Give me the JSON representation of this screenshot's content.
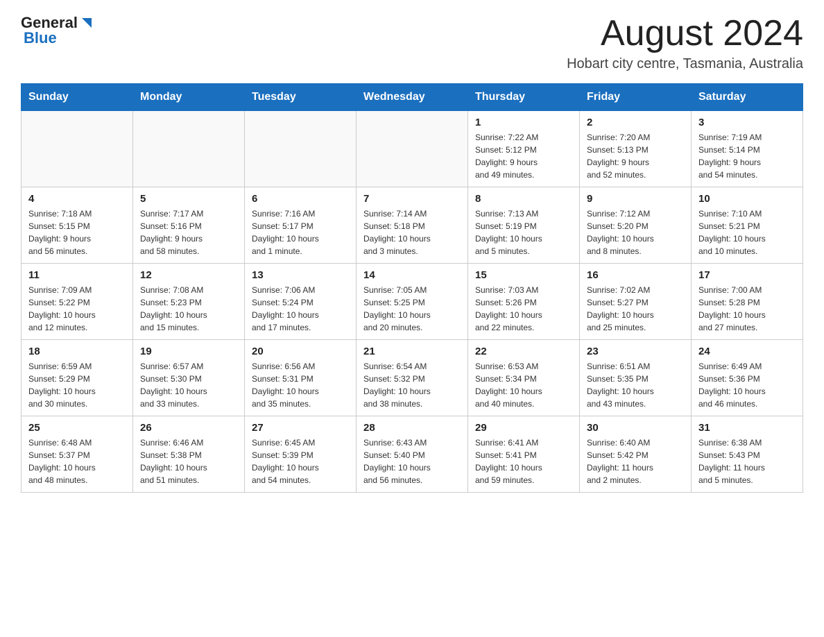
{
  "header": {
    "logo_general": "General",
    "logo_blue": "Blue",
    "title": "August 2024",
    "subtitle": "Hobart city centre, Tasmania, Australia"
  },
  "weekdays": [
    "Sunday",
    "Monday",
    "Tuesday",
    "Wednesday",
    "Thursday",
    "Friday",
    "Saturday"
  ],
  "weeks": [
    [
      {
        "day": "",
        "info": ""
      },
      {
        "day": "",
        "info": ""
      },
      {
        "day": "",
        "info": ""
      },
      {
        "day": "",
        "info": ""
      },
      {
        "day": "1",
        "info": "Sunrise: 7:22 AM\nSunset: 5:12 PM\nDaylight: 9 hours\nand 49 minutes."
      },
      {
        "day": "2",
        "info": "Sunrise: 7:20 AM\nSunset: 5:13 PM\nDaylight: 9 hours\nand 52 minutes."
      },
      {
        "day": "3",
        "info": "Sunrise: 7:19 AM\nSunset: 5:14 PM\nDaylight: 9 hours\nand 54 minutes."
      }
    ],
    [
      {
        "day": "4",
        "info": "Sunrise: 7:18 AM\nSunset: 5:15 PM\nDaylight: 9 hours\nand 56 minutes."
      },
      {
        "day": "5",
        "info": "Sunrise: 7:17 AM\nSunset: 5:16 PM\nDaylight: 9 hours\nand 58 minutes."
      },
      {
        "day": "6",
        "info": "Sunrise: 7:16 AM\nSunset: 5:17 PM\nDaylight: 10 hours\nand 1 minute."
      },
      {
        "day": "7",
        "info": "Sunrise: 7:14 AM\nSunset: 5:18 PM\nDaylight: 10 hours\nand 3 minutes."
      },
      {
        "day": "8",
        "info": "Sunrise: 7:13 AM\nSunset: 5:19 PM\nDaylight: 10 hours\nand 5 minutes."
      },
      {
        "day": "9",
        "info": "Sunrise: 7:12 AM\nSunset: 5:20 PM\nDaylight: 10 hours\nand 8 minutes."
      },
      {
        "day": "10",
        "info": "Sunrise: 7:10 AM\nSunset: 5:21 PM\nDaylight: 10 hours\nand 10 minutes."
      }
    ],
    [
      {
        "day": "11",
        "info": "Sunrise: 7:09 AM\nSunset: 5:22 PM\nDaylight: 10 hours\nand 12 minutes."
      },
      {
        "day": "12",
        "info": "Sunrise: 7:08 AM\nSunset: 5:23 PM\nDaylight: 10 hours\nand 15 minutes."
      },
      {
        "day": "13",
        "info": "Sunrise: 7:06 AM\nSunset: 5:24 PM\nDaylight: 10 hours\nand 17 minutes."
      },
      {
        "day": "14",
        "info": "Sunrise: 7:05 AM\nSunset: 5:25 PM\nDaylight: 10 hours\nand 20 minutes."
      },
      {
        "day": "15",
        "info": "Sunrise: 7:03 AM\nSunset: 5:26 PM\nDaylight: 10 hours\nand 22 minutes."
      },
      {
        "day": "16",
        "info": "Sunrise: 7:02 AM\nSunset: 5:27 PM\nDaylight: 10 hours\nand 25 minutes."
      },
      {
        "day": "17",
        "info": "Sunrise: 7:00 AM\nSunset: 5:28 PM\nDaylight: 10 hours\nand 27 minutes."
      }
    ],
    [
      {
        "day": "18",
        "info": "Sunrise: 6:59 AM\nSunset: 5:29 PM\nDaylight: 10 hours\nand 30 minutes."
      },
      {
        "day": "19",
        "info": "Sunrise: 6:57 AM\nSunset: 5:30 PM\nDaylight: 10 hours\nand 33 minutes."
      },
      {
        "day": "20",
        "info": "Sunrise: 6:56 AM\nSunset: 5:31 PM\nDaylight: 10 hours\nand 35 minutes."
      },
      {
        "day": "21",
        "info": "Sunrise: 6:54 AM\nSunset: 5:32 PM\nDaylight: 10 hours\nand 38 minutes."
      },
      {
        "day": "22",
        "info": "Sunrise: 6:53 AM\nSunset: 5:34 PM\nDaylight: 10 hours\nand 40 minutes."
      },
      {
        "day": "23",
        "info": "Sunrise: 6:51 AM\nSunset: 5:35 PM\nDaylight: 10 hours\nand 43 minutes."
      },
      {
        "day": "24",
        "info": "Sunrise: 6:49 AM\nSunset: 5:36 PM\nDaylight: 10 hours\nand 46 minutes."
      }
    ],
    [
      {
        "day": "25",
        "info": "Sunrise: 6:48 AM\nSunset: 5:37 PM\nDaylight: 10 hours\nand 48 minutes."
      },
      {
        "day": "26",
        "info": "Sunrise: 6:46 AM\nSunset: 5:38 PM\nDaylight: 10 hours\nand 51 minutes."
      },
      {
        "day": "27",
        "info": "Sunrise: 6:45 AM\nSunset: 5:39 PM\nDaylight: 10 hours\nand 54 minutes."
      },
      {
        "day": "28",
        "info": "Sunrise: 6:43 AM\nSunset: 5:40 PM\nDaylight: 10 hours\nand 56 minutes."
      },
      {
        "day": "29",
        "info": "Sunrise: 6:41 AM\nSunset: 5:41 PM\nDaylight: 10 hours\nand 59 minutes."
      },
      {
        "day": "30",
        "info": "Sunrise: 6:40 AM\nSunset: 5:42 PM\nDaylight: 11 hours\nand 2 minutes."
      },
      {
        "day": "31",
        "info": "Sunrise: 6:38 AM\nSunset: 5:43 PM\nDaylight: 11 hours\nand 5 minutes."
      }
    ]
  ]
}
